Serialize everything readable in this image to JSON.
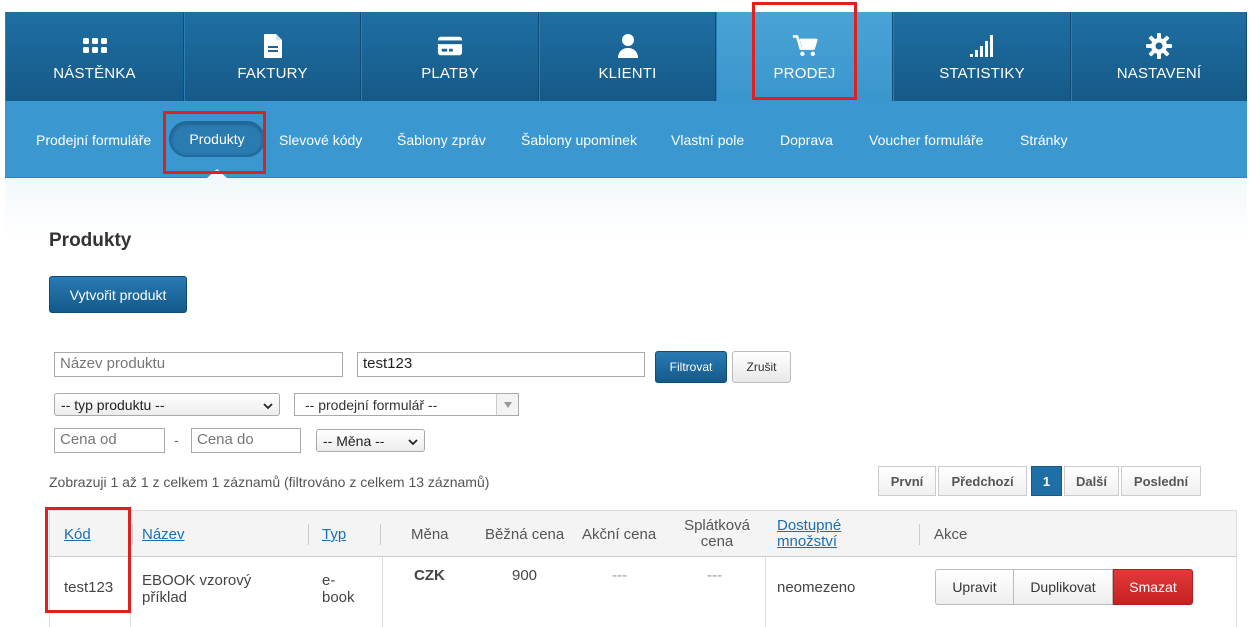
{
  "nav": {
    "tabs": [
      {
        "label": "NÁSTĚNKA",
        "icon": "dashboard-icon"
      },
      {
        "label": "FAKTURY",
        "icon": "document-icon"
      },
      {
        "label": "PLATBY",
        "icon": "credit-card-icon"
      },
      {
        "label": "KLIENTI",
        "icon": "user-icon"
      },
      {
        "label": "PRODEJ",
        "icon": "cart-icon"
      },
      {
        "label": "STATISTIKY",
        "icon": "bar-signal-icon"
      },
      {
        "label": "NASTAVENÍ",
        "icon": "gear-icon"
      }
    ],
    "active": "PRODEJ"
  },
  "subnav": {
    "items": [
      "Prodejní formuláře",
      "Produkty",
      "Slevové kódy",
      "Šablony zpráv",
      "Šablony upomínek",
      "Vlastní pole",
      "Doprava",
      "Voucher formuláře",
      "Stránky"
    ],
    "active": "Produkty"
  },
  "page": {
    "title": "Produkty",
    "create_button": "Vytvořit produkt"
  },
  "filters": {
    "name_placeholder": "Název produktu",
    "search_value": "test123",
    "filter_button": "Filtrovat",
    "reset_button": "Zrušit",
    "type_select": "-- typ produktu --",
    "form_select": "-- prodejní formulář --",
    "price_from_placeholder": "Cena od",
    "price_separator": "-",
    "price_to_placeholder": "Cena do",
    "currency_select": "-- Měna --"
  },
  "listing": {
    "info": "Zobrazuji 1 až 1 z celkem 1 záznamů (filtrováno z celkem 13 záznamů)",
    "pager": [
      "První",
      "Předchozí",
      "1",
      "Další",
      "Poslední"
    ]
  },
  "table": {
    "headers": {
      "code": "Kód",
      "name": "Název",
      "type": "Typ",
      "currency": "Měna",
      "price": "Běžná cena",
      "sale_price": "Akční cena",
      "installment_line1": "Splátková",
      "installment_line2": "cena",
      "qty_line1": "Dostupné",
      "qty_line2": "množství",
      "actions": "Akce"
    },
    "rows": [
      {
        "code": "test123",
        "name_line1": "EBOOK vzorový",
        "name_line2": "příklad",
        "type_line1": "e-",
        "type_line2": "book",
        "currency": "CZK",
        "price": "900",
        "sale_price": "---",
        "installment": "---",
        "qty": "neomezeno",
        "edit": "Upravit",
        "duplicate": "Duplikovat",
        "delete": "Smazat"
      }
    ]
  },
  "colors": {
    "nav_bg": "#1a65977",
    "active_tab": "#4aa3d6",
    "subnav_bg": "#3a97cf",
    "primary": "#1d6fa5",
    "danger": "#d22c2c",
    "highlight": "#e01f1f"
  }
}
